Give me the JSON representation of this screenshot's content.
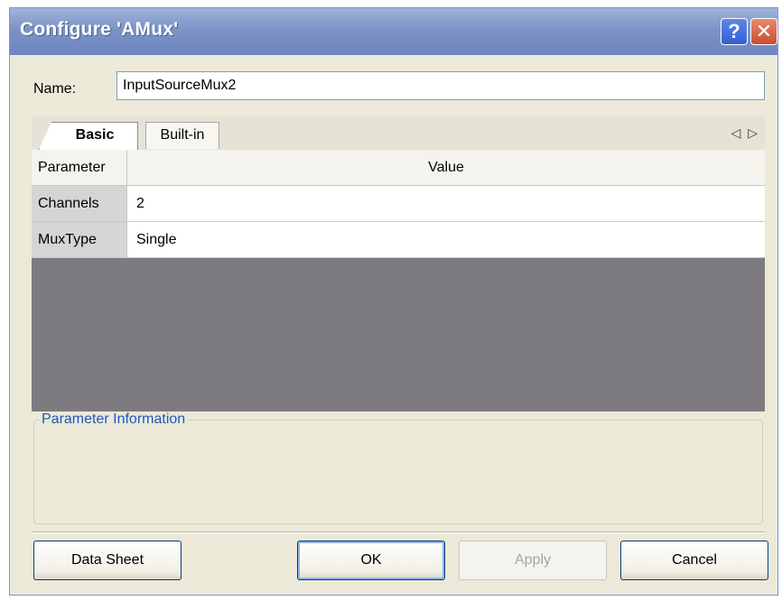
{
  "window": {
    "title": "Configure 'AMux'",
    "help_label": "?",
    "close_label": "✕"
  },
  "name_field": {
    "label": "Name:",
    "value": "InputSourceMux2"
  },
  "tabs": [
    {
      "label": "Basic",
      "selected": true
    },
    {
      "label": "Built-in",
      "selected": false
    }
  ],
  "tab_scroll": {
    "left": "◁",
    "right": "▷"
  },
  "grid": {
    "headers": {
      "parameter": "Parameter",
      "value": "Value"
    },
    "rows": [
      {
        "parameter": "Channels",
        "value": "2"
      },
      {
        "parameter": "MuxType",
        "value": "Single"
      }
    ]
  },
  "info": {
    "legend": "Parameter Information"
  },
  "buttons": {
    "data_sheet": "Data Sheet",
    "ok": "OK",
    "apply": "Apply",
    "cancel": "Cancel"
  },
  "colors": {
    "title_bar": "#7c93c6",
    "dialog_bg": "#ece9d8",
    "grid_empty": "#7e7b80",
    "info_legend": "#1c57c2"
  }
}
